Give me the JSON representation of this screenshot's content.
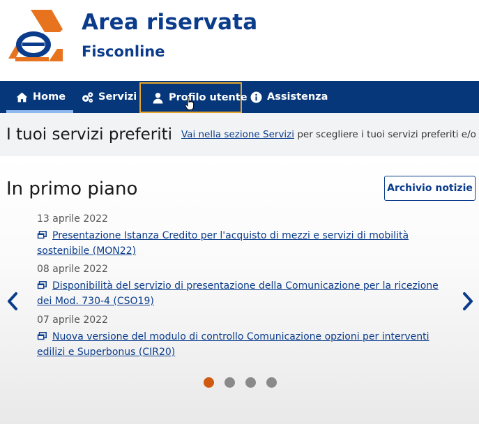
{
  "header": {
    "title": "Area riservata",
    "subtitle": "Fisconline",
    "logo_colors": {
      "orange": "#e8731e",
      "blue": "#0b3c8c"
    }
  },
  "nav": {
    "items": [
      {
        "label": "Home",
        "icon": "home-icon",
        "active": true
      },
      {
        "label": "Servizi",
        "icon": "cogs-icon"
      },
      {
        "label": "Profilo utente",
        "icon": "user-icon",
        "focused": true
      },
      {
        "label": "Assistenza",
        "icon": "info-icon"
      }
    ]
  },
  "preferiti": {
    "title": "I tuoi servizi preferiti",
    "link": "Vai nella sezione Servizi",
    "text": " per scegliere i tuoi servizi preferiti e/o ce"
  },
  "primo_piano": {
    "title": "In primo piano",
    "archive_button": "Archivio notizie",
    "news": [
      {
        "date": "13 aprile 2022",
        "title": "Presentazione Istanza Credito per l'acquisto di mezzi e servizi di mobilità sostenibile (MON22)"
      },
      {
        "date": "08 aprile 2022",
        "title": "Disponibilità del servizio di presentazione della Comunicazione per la ricezione dei Mod. 730-4 (CSO19)"
      },
      {
        "date": "07 aprile 2022",
        "title": "Nuova versione del modulo di controllo Comunicazione opzioni per interventi edilizi e Superbonus (CIR20)"
      }
    ],
    "carousel": {
      "slides": 4,
      "active_slide": 1
    }
  },
  "colors": {
    "primary": "#0b3c8c",
    "nav_bg": "#06377a",
    "accent": "#d05a12",
    "focus": "#e7a52d"
  }
}
